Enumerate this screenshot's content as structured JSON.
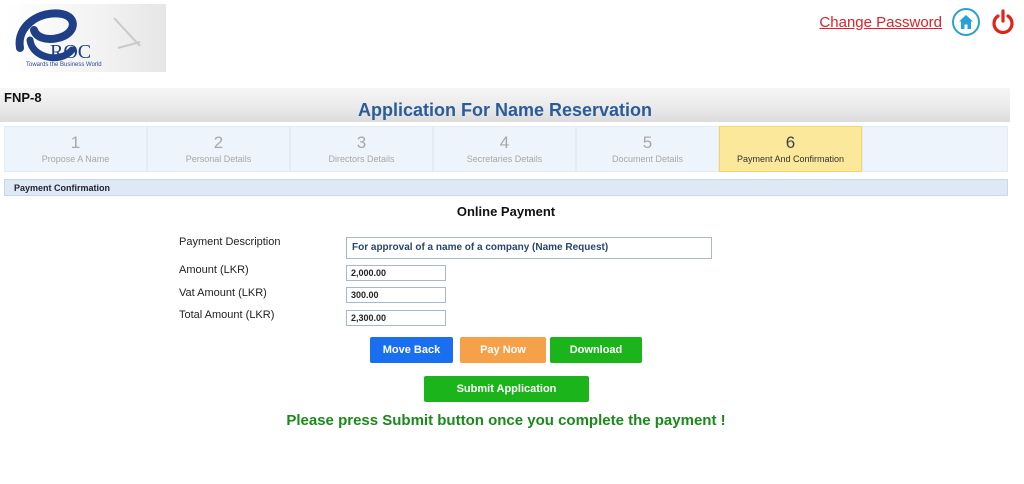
{
  "logo": {
    "letters": "ROC",
    "tagline": "Towards the Business World"
  },
  "header": {
    "change_password": "Change Password",
    "home_icon": "home-icon",
    "power_icon": "power-icon",
    "colors": {
      "link": "#e0202a",
      "home": "#2aa0d8",
      "power": "#e2231a"
    }
  },
  "title_bar": {
    "form_code": "FNP-8",
    "title": "Application For Name Reservation"
  },
  "steps": [
    {
      "number": "1",
      "label": "Propose A Name"
    },
    {
      "number": "2",
      "label": "Personal Details"
    },
    {
      "number": "3",
      "label": "Directors Details"
    },
    {
      "number": "4",
      "label": "Secretaries Details"
    },
    {
      "number": "5",
      "label": "Document Details"
    },
    {
      "number": "6",
      "label": "Payment And Confirmation"
    }
  ],
  "active_step": 6,
  "section": {
    "title": "Payment Confirmation"
  },
  "payment": {
    "heading": "Online Payment",
    "description_label": "Payment Description",
    "description_value": "For approval of a name of a company (Name Request)",
    "amount_label": "Amount (LKR)",
    "amount_value": "2,000.00",
    "vat_label": "Vat Amount (LKR)",
    "vat_value": "300.00",
    "total_label": "Total Amount (LKR)",
    "total_value": "2,300.00"
  },
  "buttons": {
    "move_back": "Move Back",
    "pay_now": "Pay Now",
    "download": "Download",
    "submit": "Submit Application"
  },
  "notice": "Please press Submit button once you complete the payment !"
}
